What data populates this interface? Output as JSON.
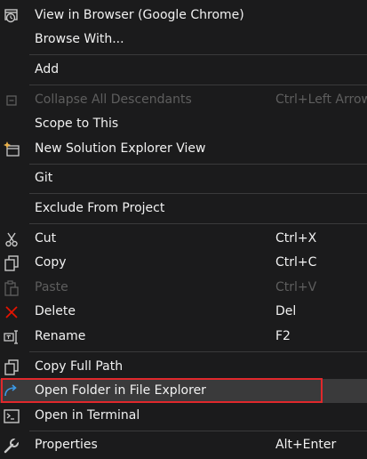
{
  "menu": {
    "items": [
      {
        "label": "View in Browser (Google Chrome)",
        "shortcut": "",
        "icon": "browser-icon",
        "disabled": false
      },
      {
        "label": "Browse With...",
        "shortcut": "",
        "icon": "",
        "disabled": false
      },
      {
        "label": "Add",
        "shortcut": "",
        "icon": "",
        "disabled": false
      },
      {
        "label": "Collapse All Descendants",
        "shortcut": "Ctrl+Left Arrow",
        "icon": "collapse-icon",
        "disabled": true
      },
      {
        "label": "Scope to This",
        "shortcut": "",
        "icon": "",
        "disabled": false
      },
      {
        "label": "New Solution Explorer View",
        "shortcut": "",
        "icon": "new-view-icon",
        "disabled": false
      },
      {
        "label": "Git",
        "shortcut": "",
        "icon": "",
        "disabled": false
      },
      {
        "label": "Exclude From Project",
        "shortcut": "",
        "icon": "",
        "disabled": false
      },
      {
        "label": "Cut",
        "shortcut": "Ctrl+X",
        "icon": "scissors-icon",
        "disabled": false
      },
      {
        "label": "Copy",
        "shortcut": "Ctrl+C",
        "icon": "copy-icon",
        "disabled": false
      },
      {
        "label": "Paste",
        "shortcut": "Ctrl+V",
        "icon": "paste-icon",
        "disabled": true
      },
      {
        "label": "Delete",
        "shortcut": "Del",
        "icon": "delete-icon",
        "disabled": false
      },
      {
        "label": "Rename",
        "shortcut": "F2",
        "icon": "rename-icon",
        "disabled": false
      },
      {
        "label": "Copy Full Path",
        "shortcut": "",
        "icon": "copy-path-icon",
        "disabled": false
      },
      {
        "label": "Open Folder in File Explorer",
        "shortcut": "",
        "icon": "open-folder-arrow-icon",
        "disabled": false,
        "highlighted": true
      },
      {
        "label": "Open in Terminal",
        "shortcut": "",
        "icon": "terminal-icon",
        "disabled": false
      },
      {
        "label": "Properties",
        "shortcut": "Alt+Enter",
        "icon": "wrench-icon",
        "disabled": false
      }
    ]
  },
  "colors": {
    "background": "#1b1b1c",
    "text": "#f1f1f1",
    "disabled_text": "#5e5e5e",
    "highlight": "#3a3a3b",
    "focus_border": "#e0282c",
    "delete_icon": "#e51400",
    "accent_icon": "#3c9ae8"
  }
}
